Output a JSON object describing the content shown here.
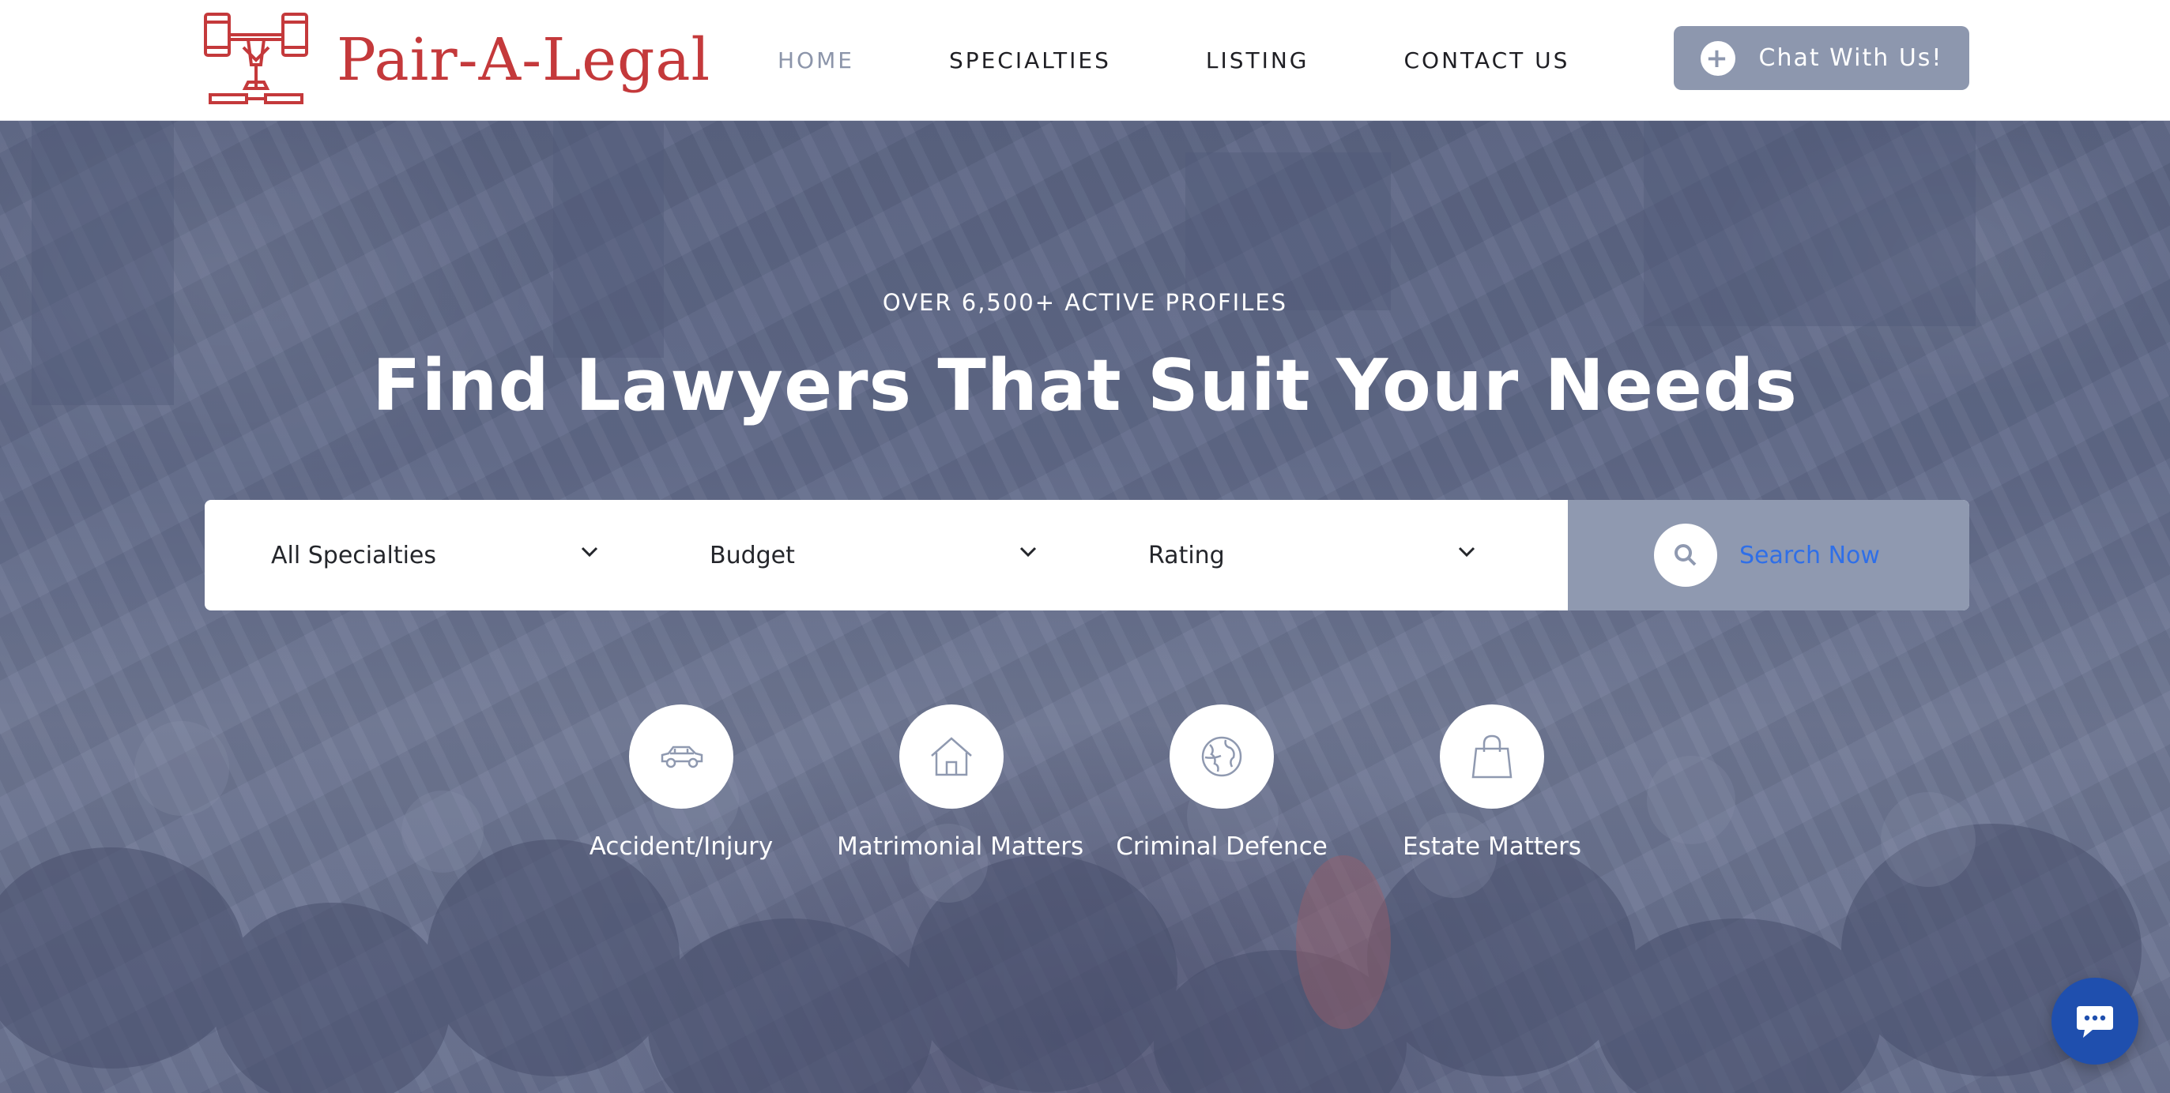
{
  "header": {
    "brand": "Pair-A-Legal",
    "nav": [
      {
        "label": "HOME",
        "active": true
      },
      {
        "label": "SPECIALTIES",
        "active": false
      },
      {
        "label": "LISTING",
        "active": false
      },
      {
        "label": "CONTACT US",
        "active": false
      }
    ],
    "chat_button": {
      "label": "Chat With Us!",
      "icon": "plus-icon"
    }
  },
  "hero": {
    "eyebrow": "OVER 6,500+ ACTIVE PROFILES",
    "title": "Find Lawyers That Suit Your Needs",
    "search": {
      "filters": [
        {
          "selected": "All Specialties",
          "icon": "chevron-down-icon"
        },
        {
          "selected": "Budget",
          "icon": "chevron-down-icon"
        },
        {
          "selected": "Rating",
          "icon": "chevron-down-icon"
        }
      ],
      "submit_label": "Search Now",
      "submit_icon": "search-icon"
    },
    "categories": [
      {
        "label": "Accident/Injury",
        "icon": "car-icon"
      },
      {
        "label": "Matrimonial Matters",
        "icon": "house-icon"
      },
      {
        "label": "Criminal Defence",
        "icon": "globe-icon"
      },
      {
        "label": "Estate Matters",
        "icon": "shopping-bag-icon"
      }
    ]
  },
  "chat_widget": {
    "icon": "chat-bubble-icon"
  },
  "colors": {
    "brand_red": "#c4393b",
    "nav_active": "#8c95aa",
    "button_slate": "#8d97ae",
    "search_link_blue": "#2f6fe8",
    "chat_widget_blue": "#1f4fae"
  }
}
